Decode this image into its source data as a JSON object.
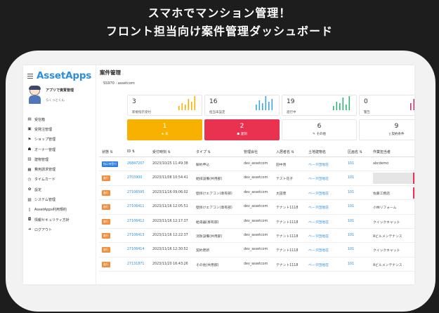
{
  "headline": {
    "line1": "スマホでマンション管理！",
    "line2": "フロント担当向け案件管理ダッシュボード"
  },
  "sidebar": {
    "logo": "AssetApps",
    "user_name": "アプリで資質管理",
    "user_sub": "らくっとくん",
    "items": [
      {
        "label": "受信箱",
        "icon": "inbox-icon"
      },
      {
        "label": "受発注管理",
        "icon": "order-icon"
      },
      {
        "label": "ショップ管理",
        "icon": "shop-icon"
      },
      {
        "label": "オーナー管理",
        "icon": "owner-icon"
      },
      {
        "label": "建物管理",
        "icon": "building-icon"
      },
      {
        "label": "費用請求管理",
        "icon": "billing-icon"
      },
      {
        "label": "タイムカード",
        "icon": "clock-icon"
      },
      {
        "label": "設定",
        "icon": "gear-icon"
      },
      {
        "label": "システム管理",
        "icon": "system-icon"
      },
      {
        "label": "AssetApps利用規約",
        "icon": "document-icon"
      },
      {
        "label": "情報セキュリティ方針",
        "icon": "lock-icon"
      },
      {
        "label": "ログアウト",
        "icon": "logout-icon"
      }
    ]
  },
  "main": {
    "title": "案件管理",
    "tenant": "SS970 : assetcom",
    "stats": [
      {
        "value": "3",
        "label": "新規指示受付",
        "color": "#f7b100",
        "bars": [
          0.3,
          0.5,
          0.4,
          0.8,
          0.6,
          1.0
        ]
      },
      {
        "value": "16",
        "label": "担当未設定",
        "color": "#3aa8e0",
        "bars": [
          0.4,
          0.7,
          0.5,
          1.0,
          0.6,
          0.8
        ]
      },
      {
        "value": "19",
        "label": "進行中",
        "color": "#2bb673",
        "bars": [
          0.3,
          0.6,
          0.5,
          0.9,
          0.4,
          1.0
        ]
      },
      {
        "value": "0",
        "label": "警告",
        "color": "#c0326b",
        "bars": [
          0.5,
          0.8,
          0.4,
          1.0,
          0.6,
          0.7
        ]
      }
    ],
    "actions": [
      {
        "value": "1",
        "label": "★ 未",
        "style": "yellow"
      },
      {
        "value": "2",
        "label": "☗ 遅刻",
        "style": "red"
      },
      {
        "value": "6",
        "label": "その他",
        "style": "white",
        "icon": "wrench-icon"
      },
      {
        "value": "9",
        "label": "契約条件",
        "style": "white",
        "icon": "document-icon"
      }
    ],
    "table": {
      "headers": [
        "状態",
        "ID",
        "受付時刻",
        "タイプ",
        "管理会社",
        "入居者名",
        "土地建物名",
        "区画名",
        "作業担当者"
      ],
      "rows": [
        {
          "status": "指示待受付",
          "status_color": "blue",
          "id": "26847207",
          "time": "2023/10/25 11:49:38",
          "type": "解約申込",
          "company": "dev_assetcom",
          "tenant": "田中善",
          "building": "ベータ団地荘",
          "unit": "101",
          "worker": "abcdemo"
        },
        {
          "status": "進行",
          "status_color": "orange",
          "id": "2703900",
          "time": "2023/11/08 10:54:41",
          "type": "給排設備(共用部)",
          "company": "dev_assetcom",
          "tenant": "テスト花子",
          "building": "ベータ団地荘",
          "unit": "101",
          "worker": ""
        },
        {
          "status": "進行",
          "status_color": "orange",
          "id": "27106595",
          "time": "2023/11/16 09:06:02",
          "type": "壁掛けエアコン(専有部)",
          "company": "dev_assetcom",
          "tenant": "太田恵",
          "building": "ベータ団地荘",
          "unit": "101",
          "worker": "佐藤工務店"
        },
        {
          "status": "進行",
          "status_color": "orange",
          "id": "27106411",
          "time": "2023/11/16 12:05:51",
          "type": "壁掛けエアコン(専有部)",
          "company": "dev_assetcom",
          "tenant": "テナント1118",
          "building": "ベータ団地荘",
          "unit": "101",
          "worker": "小林リフォーム"
        },
        {
          "status": "進行",
          "status_color": "orange",
          "id": "27106412",
          "time": "2023/11/16 12:17:37",
          "type": "給湯器(専有部)",
          "company": "dev_assetcom",
          "tenant": "テナント1118",
          "building": "ベータ団地荘",
          "unit": "101",
          "worker": "クイックキャット"
        },
        {
          "status": "進行",
          "status_color": "orange",
          "id": "27106413",
          "time": "2023/11/16 12:22:37",
          "type": "消防設備(共用部)",
          "company": "dev_assetcom",
          "tenant": "テナント1118",
          "building": "ベータ団地荘",
          "unit": "101",
          "worker": "Aビルメンテナンス"
        },
        {
          "status": "進行",
          "status_color": "orange",
          "id": "27106414",
          "time": "2023/11/16 12:30:52",
          "type": "契約更新",
          "company": "dev_assetcom",
          "tenant": "テナント1118",
          "building": "ベータ団地荘",
          "unit": "101",
          "worker": "クイックキャット"
        },
        {
          "status": "進行",
          "status_color": "orange",
          "id": "27131871",
          "time": "2023/11/20 16:43:26",
          "type": "その他(共用部)",
          "company": "dev_assetcom",
          "tenant": "テナント1118",
          "building": "ベータ団地荘",
          "unit": "101",
          "worker": "Aビルメンテナンス"
        }
      ]
    }
  }
}
